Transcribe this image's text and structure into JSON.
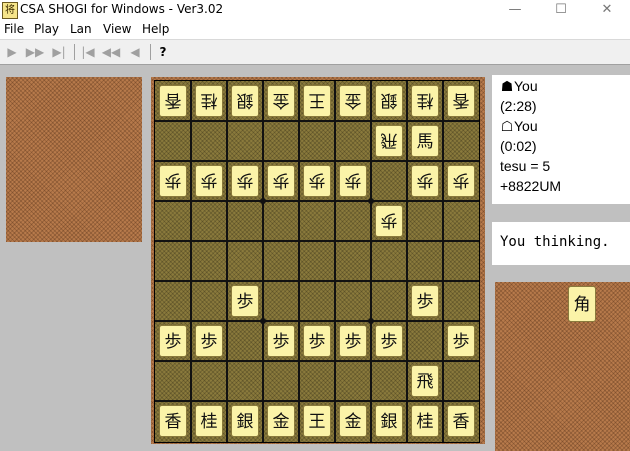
{
  "window": {
    "title": "CSA SHOGI for Windows - Ver3.02",
    "app_icon_glyph": "将",
    "min_glyph": "—",
    "max_glyph": "☐",
    "close_glyph": "✕"
  },
  "menu": {
    "items": [
      "File",
      "Play",
      "Lan",
      "View",
      "Help"
    ]
  },
  "toolbar": {
    "buttons": [
      {
        "name": "play-icon",
        "glyph": "▶"
      },
      {
        "name": "fast-forward-icon",
        "glyph": "▶▶"
      },
      {
        "name": "skip-to-end-icon",
        "glyph": "▶|"
      },
      {
        "name": "skip-to-start-icon",
        "glyph": "|◀"
      },
      {
        "name": "rewind-icon",
        "glyph": "◀◀"
      },
      {
        "name": "back-icon",
        "glyph": "◀"
      },
      {
        "name": "help-icon",
        "glyph": "?"
      }
    ]
  },
  "board": {
    "rows": [
      [
        {
          "k": "香",
          "g": true
        },
        {
          "k": "桂",
          "g": true
        },
        {
          "k": "銀",
          "g": true
        },
        {
          "k": "金",
          "g": true
        },
        {
          "k": "王",
          "g": true
        },
        {
          "k": "金",
          "g": true
        },
        {
          "k": "銀",
          "g": true
        },
        {
          "k": "桂",
          "g": true
        },
        {
          "k": "香",
          "g": true
        }
      ],
      [
        null,
        null,
        null,
        null,
        null,
        null,
        {
          "k": "飛",
          "g": true
        },
        {
          "k": "馬",
          "g": false
        },
        null
      ],
      [
        {
          "k": "歩",
          "g": true
        },
        {
          "k": "歩",
          "g": true
        },
        {
          "k": "歩",
          "g": true
        },
        {
          "k": "歩",
          "g": true
        },
        {
          "k": "歩",
          "g": true
        },
        {
          "k": "歩",
          "g": true
        },
        null,
        {
          "k": "歩",
          "g": true
        },
        {
          "k": "歩",
          "g": true
        }
      ],
      [
        null,
        null,
        null,
        null,
        null,
        null,
        {
          "k": "歩",
          "g": true
        },
        null,
        null
      ],
      [
        null,
        null,
        null,
        null,
        null,
        null,
        null,
        null,
        null
      ],
      [
        null,
        null,
        {
          "k": "歩",
          "g": false
        },
        null,
        null,
        null,
        null,
        {
          "k": "歩",
          "g": false
        },
        null
      ],
      [
        {
          "k": "歩",
          "g": false
        },
        {
          "k": "歩",
          "g": false
        },
        null,
        {
          "k": "歩",
          "g": false
        },
        {
          "k": "歩",
          "g": false
        },
        {
          "k": "歩",
          "g": false
        },
        {
          "k": "歩",
          "g": false
        },
        null,
        {
          "k": "歩",
          "g": false
        }
      ],
      [
        null,
        null,
        null,
        null,
        null,
        null,
        null,
        {
          "k": "飛",
          "g": false
        },
        null
      ],
      [
        {
          "k": "香",
          "g": false
        },
        {
          "k": "桂",
          "g": false
        },
        {
          "k": "銀",
          "g": false
        },
        {
          "k": "金",
          "g": false
        },
        {
          "k": "王",
          "g": false
        },
        {
          "k": "金",
          "g": false
        },
        {
          "k": "銀",
          "g": false
        },
        {
          "k": "桂",
          "g": false
        },
        {
          "k": "香",
          "g": false
        }
      ]
    ]
  },
  "info": {
    "sente_mark": "☗",
    "sente_name": "You",
    "sente_time": "(2:28)",
    "gote_mark": "☖",
    "gote_name": "You",
    "gote_time": "(0:02)",
    "tesu": "tesu = 5",
    "last_move": "+8822UM"
  },
  "status": {
    "message": "You thinking."
  },
  "hand": {
    "sente_pieces": [
      "角"
    ]
  }
}
